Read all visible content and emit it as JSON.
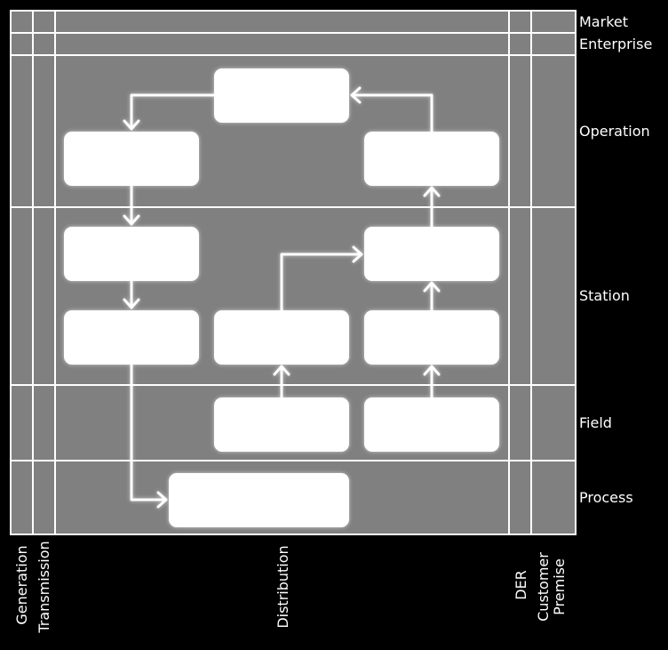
{
  "zones": [
    "Market",
    "Enterprise",
    "Operation",
    "Station",
    "Field",
    "Process"
  ],
  "domains": {
    "generation": "Generation",
    "transmission": "Transmission",
    "distribution": "Distribution",
    "der": "DER",
    "customer_premise_line1": "Customer",
    "customer_premise_line2": "Premise"
  },
  "colors": {
    "background": "#000000",
    "plane": "#808080",
    "lines": "#ffffff",
    "boxes": "#ffffff"
  }
}
